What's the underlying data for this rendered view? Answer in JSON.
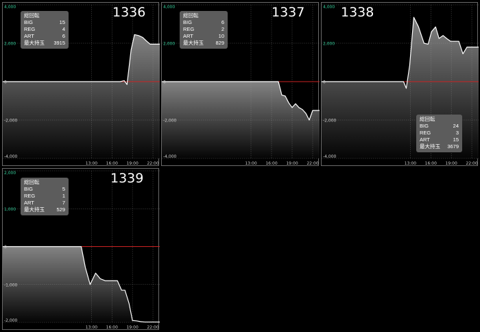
{
  "stats_labels": {
    "title": "総回転",
    "big": "BIG",
    "reg": "REG",
    "art": "ART",
    "max": "最大持玉"
  },
  "colors": {
    "zero_line": "#cc2222",
    "series_line": "#ffffff",
    "positive_tick": "#33cc99",
    "negative_tick": "#cfcfcf"
  },
  "chart_data": [
    {
      "type": "area",
      "machine": "1336",
      "stats": {
        "big": "15",
        "reg": "4",
        "art": "6",
        "max": "3915"
      },
      "x_ticks": [
        "13:00",
        "16:00",
        "19:00",
        "22:00"
      ],
      "y_ticks": [
        "4,000",
        "2,000",
        "0",
        "-2,000",
        "-4,000"
      ],
      "ylim": [
        -4000,
        4000
      ],
      "x": [
        0,
        12,
        12.6,
        13.2,
        13.7,
        14.3,
        14.9,
        15.5,
        16.1,
        16.6,
        17.2,
        17.8,
        18.2,
        18.8,
        19.3,
        19.9,
        20.5,
        21.1,
        21.6,
        22.2,
        22.7,
        23
      ],
      "y": [
        0,
        0,
        0,
        0,
        0,
        0,
        0,
        0,
        0,
        0,
        0,
        50,
        -150,
        1650,
        2450,
        2400,
        2300,
        2100,
        1950,
        1950,
        1950,
        1950
      ]
    },
    {
      "type": "area",
      "machine": "1337",
      "stats": {
        "big": "6",
        "reg": "2",
        "art": "10",
        "max": "829"
      },
      "x_ticks": [
        "13:00",
        "16:00",
        "19:00",
        "22:00"
      ],
      "y_ticks": [
        "4,000",
        "2,000",
        "0",
        "-2,000",
        "-4,000"
      ],
      "ylim": [
        -4000,
        4000
      ],
      "x": [
        0,
        12,
        13,
        14,
        15,
        16,
        17,
        17.5,
        18,
        18.5,
        19,
        19.5,
        20,
        20.5,
        21,
        21.5,
        22,
        22.5,
        23
      ],
      "y": [
        0,
        0,
        0,
        0,
        0,
        0,
        0,
        -700,
        -750,
        -1100,
        -1350,
        -1150,
        -1350,
        -1450,
        -1650,
        -2000,
        -1500,
        -1500,
        -1500
      ]
    },
    {
      "type": "area",
      "machine": "1338",
      "stats": {
        "big": "24",
        "reg": "3",
        "art": "15",
        "max": "3679"
      },
      "x_ticks": [
        "13:00",
        "16:00",
        "19:00",
        "22:00"
      ],
      "y_ticks": [
        "4,000",
        "2,000",
        "0",
        "-2,000",
        "-4,000"
      ],
      "ylim": [
        -4000,
        4000
      ],
      "x": [
        0,
        12,
        12.4,
        12.9,
        13.5,
        14.2,
        15,
        15.6,
        16.1,
        16.7,
        17.2,
        17.8,
        18.3,
        18.9,
        19.5,
        20.1,
        20.7,
        21.3,
        21.8,
        22.4,
        23
      ],
      "y": [
        0,
        0,
        -350,
        850,
        3350,
        2850,
        2000,
        1950,
        2600,
        2850,
        2250,
        2400,
        2250,
        2100,
        2100,
        2100,
        1450,
        1800,
        1800,
        1800,
        1800
      ]
    },
    {
      "type": "area",
      "machine": "1339",
      "stats": {
        "big": "5",
        "reg": "1",
        "art": "7",
        "max": "529"
      },
      "x_ticks": [
        "13:00",
        "16:00",
        "19:00",
        "22:00"
      ],
      "y_ticks": [
        "2,000",
        "1,000",
        "0",
        "-1,000",
        "-2,000"
      ],
      "ylim": [
        -2000,
        2000
      ],
      "x": [
        0,
        10.5,
        11.5,
        12.1,
        12.8,
        13.6,
        14.3,
        15,
        15.7,
        16.2,
        16.8,
        17.4,
        17.9,
        18.5,
        19,
        19.6,
        20.2,
        20.8,
        21.3,
        21.9,
        22.5,
        23
      ],
      "y": [
        0,
        0,
        0,
        -550,
        -1000,
        -700,
        -850,
        -900,
        -900,
        -900,
        -900,
        -1150,
        -1150,
        -1500,
        -1950,
        -1960,
        -1980,
        -1990,
        -1990,
        -1990,
        -1990,
        -1990
      ]
    }
  ]
}
